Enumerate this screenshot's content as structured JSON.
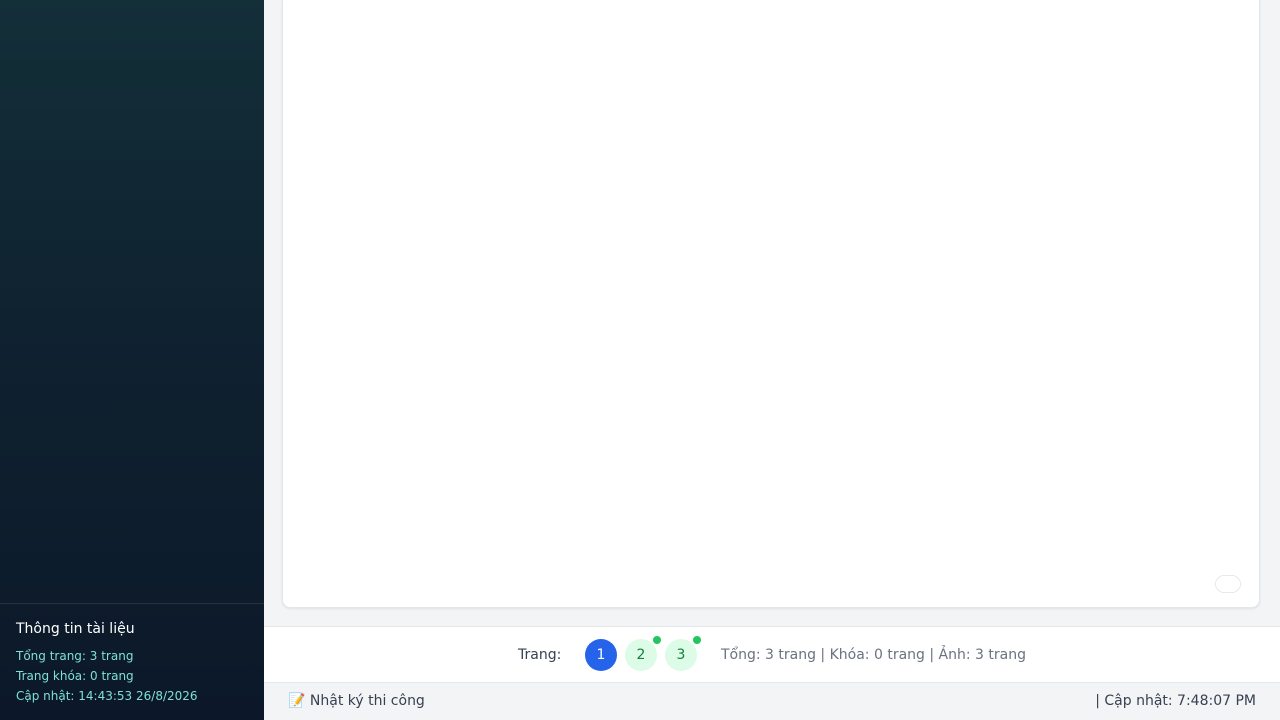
{
  "sidebar": {
    "info": {
      "title": "Thông tin tài liệu",
      "total_pages": "Tổng trang: 3 trang",
      "locked_pages": "Trang khóa: 0 trang",
      "updated": "Cập nhật: 14:43:53 26/8/2026"
    }
  },
  "pager": {
    "label": "Trang:",
    "pages": [
      {
        "label": "1",
        "active": true,
        "has_image": false
      },
      {
        "label": "2",
        "active": false,
        "has_image": true
      },
      {
        "label": "3",
        "active": false,
        "has_image": true
      }
    ],
    "summary": "Tổng: 3 trang | Khóa: 0 trang | Ảnh: 3 trang"
  },
  "status_bar": {
    "left_icon": "memo-icon",
    "left_icon_glyph": "📝",
    "left_text": "Nhật ký thi công",
    "right_text": "| Cập nhật: 7:48:07 PM"
  },
  "colors": {
    "active_page": "#2563eb",
    "page_bg": "#dcfce7",
    "page_dot": "#22c55e",
    "sidebar_accent": "#7ee0d8"
  }
}
